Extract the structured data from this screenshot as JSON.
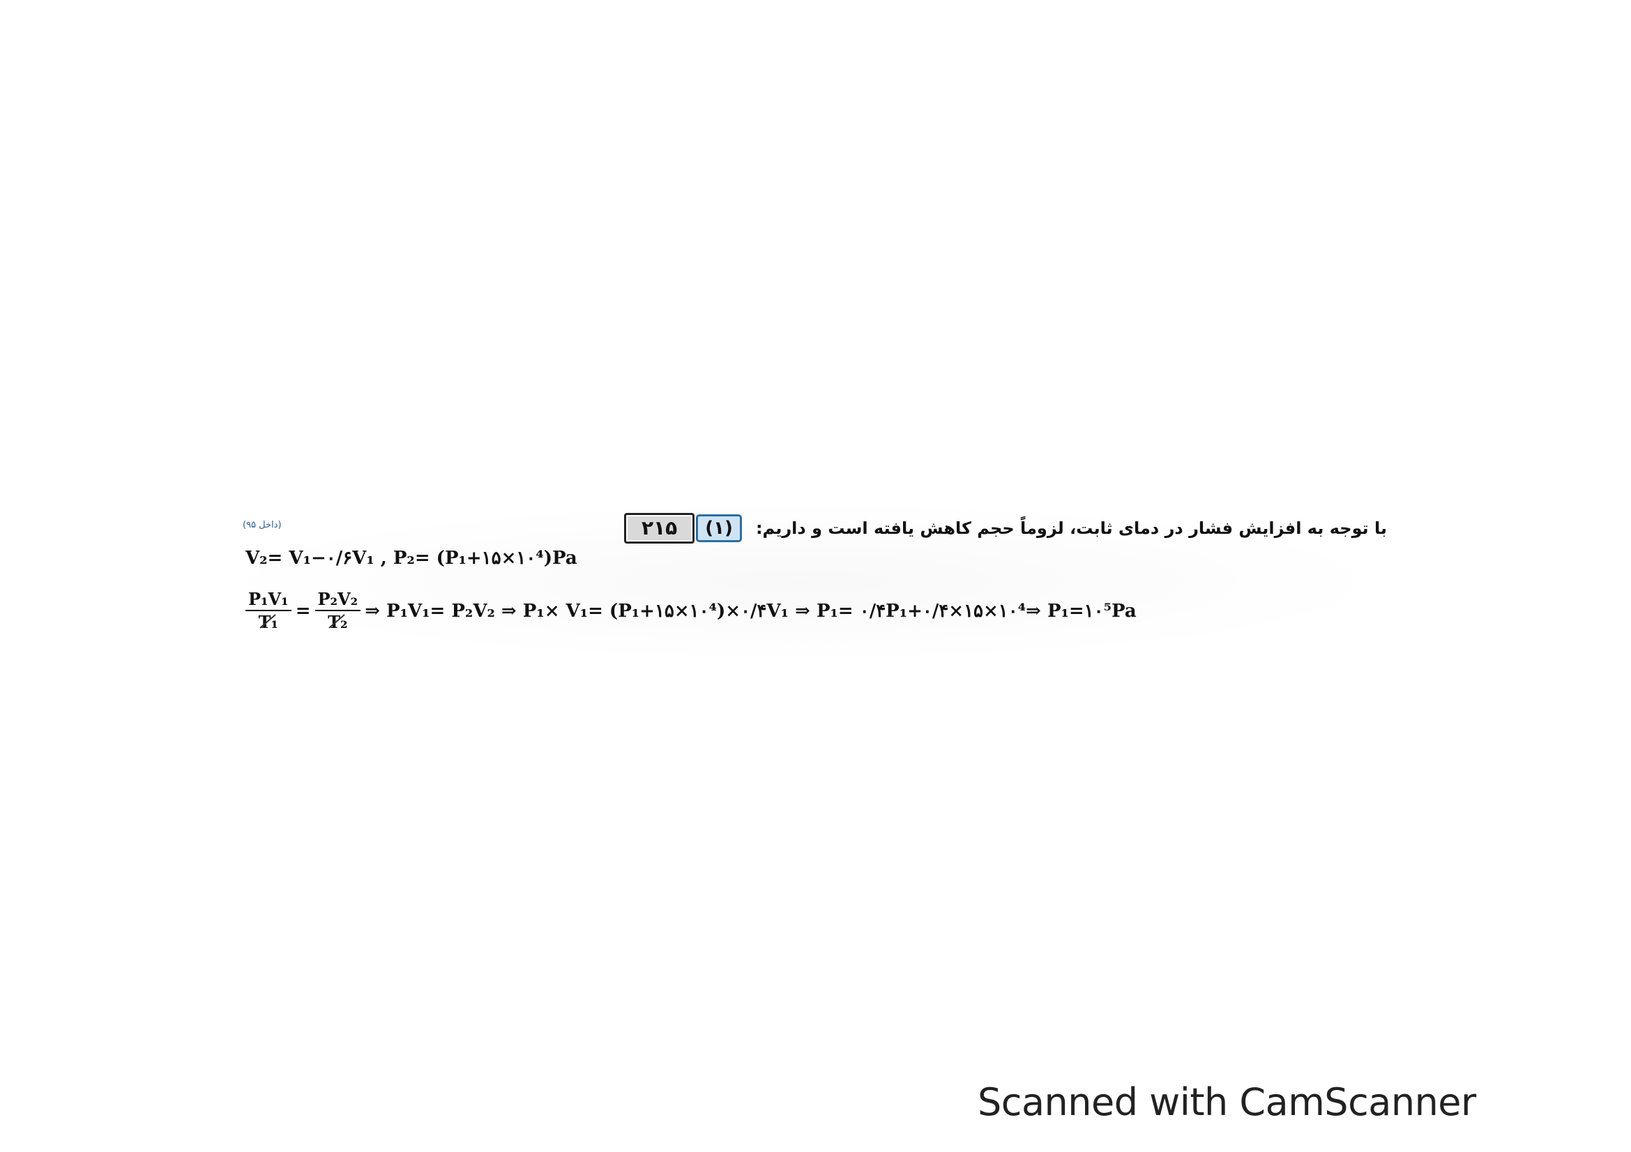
{
  "question": {
    "number": "۲۱۵",
    "option": "(۱)",
    "intro": "با توجه به افزایش فشار در دمای ثابت، لزوماً حجم کاهش یافته است و داریم:",
    "source": "(داخل ۹۵)"
  },
  "equations": {
    "line1": "V₂= V₁−۰/۶V₁  ,  P₂= (P₁+۱۵×۱۰⁴)Pa",
    "line2": {
      "frac_left_num": "P₁V₁",
      "frac_left_den": "T₁",
      "equals": "=",
      "frac_right_num": "P₂V₂",
      "frac_right_den": "T₂",
      "rest": "⇒ P₁V₁= P₂V₂ ⇒ P₁× V₁= (P₁+۱۵×۱۰⁴)×۰/۴V₁  ⇒ P₁= ۰/۴P₁+۰/۴×۱۵×۱۰⁴⇒ P₁=۱۰⁵Pa"
    }
  },
  "footer": {
    "watermark": "Scanned with CamScanner"
  }
}
